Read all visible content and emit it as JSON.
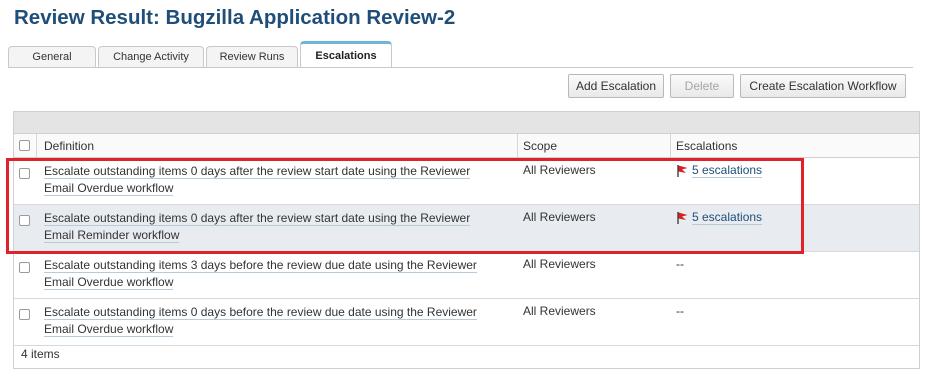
{
  "page": {
    "title": "Review Result: Bugzilla Application Review-2"
  },
  "tabs": [
    {
      "label": "General"
    },
    {
      "label": "Change Activity"
    },
    {
      "label": "Review Runs"
    },
    {
      "label": "Escalations"
    }
  ],
  "active_tab": "Escalations",
  "toolbar": {
    "add_label": "Add Escalation",
    "delete_label": "Delete",
    "create_label": "Create Escalation Workflow"
  },
  "table": {
    "columns": [
      "Definition",
      "Scope",
      "Escalations"
    ],
    "rows": [
      {
        "definition_line1": "Escalate outstanding items 0 days after the review start date using the Reviewer",
        "definition_line2": "Email Overdue workflow",
        "scope": "All Reviewers",
        "escalations": "5 escalations"
      },
      {
        "definition_line1": "Escalate outstanding items 0 days after the review start date using the Reviewer",
        "definition_line2": "Email Reminder workflow",
        "scope": "All Reviewers",
        "escalations": "5 escalations"
      },
      {
        "definition_line1": "Escalate outstanding items 3 days before the review due date using the Reviewer",
        "definition_line2": "Email Overdue workflow",
        "scope": "All Reviewers",
        "escalations": "--"
      },
      {
        "definition_line1": "Escalate outstanding items 0 days before the review due date using the Reviewer",
        "definition_line2": "Email Overdue workflow",
        "scope": "All Reviewers",
        "escalations": "--"
      }
    ],
    "footer": "4 items"
  },
  "colors": {
    "title": "#1f4e79",
    "active_tab_accent": "#6fb4dc",
    "highlight_box": "#e0232b",
    "flag": "#d92020"
  },
  "icons": {
    "escalation_flag": "red-flag-icon",
    "row_checkbox": "checkbox"
  }
}
